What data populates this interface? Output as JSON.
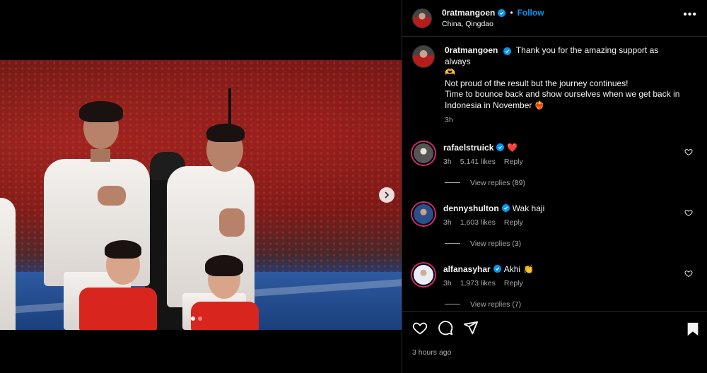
{
  "post": {
    "username": "0ratmangoen",
    "follow_label": "Follow",
    "separator": "•",
    "location": "China, Qingdao",
    "more_label": "•••",
    "caption_line1": "Thank you for the amazing support as always",
    "caption_emoji1": "🫶",
    "caption_line2": "Not proud of the result but the journey continues!",
    "caption_line3": "Time to bounce back and show ourselves when we get back in Indonesia in November",
    "caption_emoji2": "❤️‍🔥",
    "caption_time": "3h",
    "posted_ago": "3 hours ago"
  },
  "comments": [
    {
      "username": "rafaelstruick",
      "text": "",
      "emoji": "❤️",
      "time": "3h",
      "likes": "5,141 likes",
      "reply_label": "Reply",
      "view_replies": "View replies (89)"
    },
    {
      "username": "dennyshulton",
      "text": "Wak haji",
      "emoji": "",
      "time": "3h",
      "likes": "1,603 likes",
      "reply_label": "Reply",
      "view_replies": "View replies (3)"
    },
    {
      "username": "alfanasyhar",
      "text": "Akhi",
      "emoji": "👏",
      "time": "3h",
      "likes": "1,973 likes",
      "reply_label": "Reply",
      "view_replies": "View replies (7)"
    }
  ],
  "icons": {
    "like": "heart-icon",
    "comment": "comment-icon",
    "share": "share-icon",
    "save": "bookmark-icon",
    "next": "chevron-right-icon",
    "verified": "verified-badge-icon"
  },
  "colors": {
    "link": "#0095f6",
    "secondary_text": "#a8a8a8",
    "border": "#262626",
    "ring": "#d62976"
  }
}
